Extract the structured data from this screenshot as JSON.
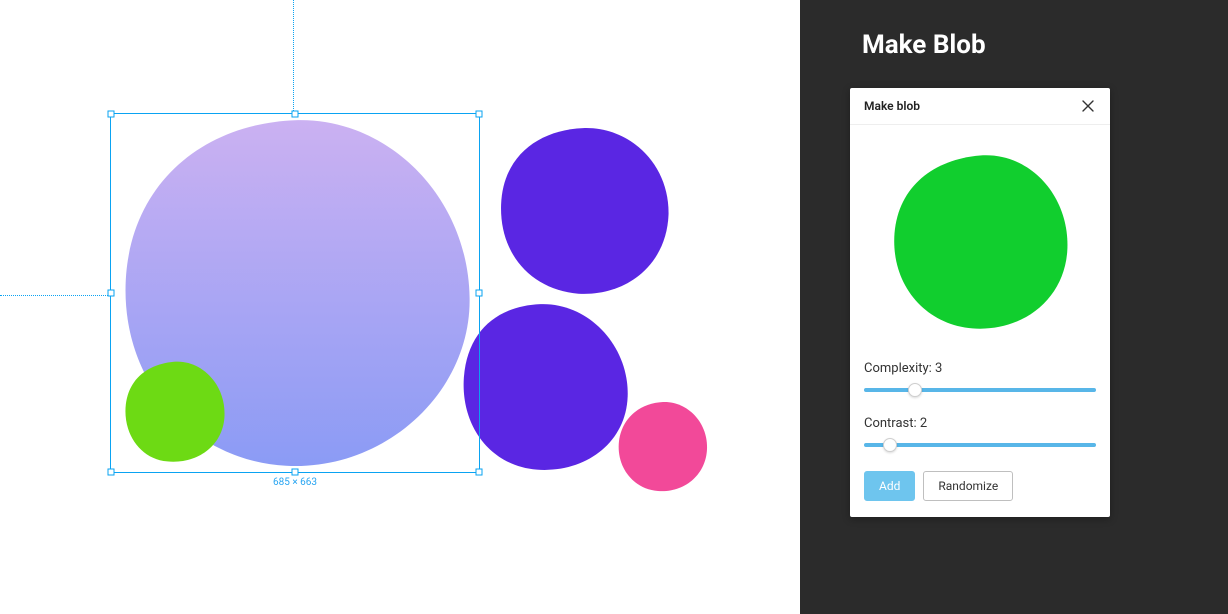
{
  "sidebar": {
    "title": "Make Blob"
  },
  "panel": {
    "title": "Make blob",
    "complexity": {
      "label": "Complexity:",
      "value": 3,
      "percent": 22
    },
    "contrast": {
      "label": "Contrast:",
      "value": 2,
      "percent": 11
    },
    "add_label": "Add",
    "randomize_label": "Randomize",
    "preview_color": "#11ce2e"
  },
  "canvas": {
    "selection_dimensions": "685 × 663",
    "blobs": {
      "main_gradient": {
        "from": "#cbb1f2",
        "to": "#8b9bf5"
      },
      "purple": "#5a26e3",
      "green": "#6dda14",
      "pink": "#f24999"
    },
    "selection_color": "#0aa3f2"
  }
}
